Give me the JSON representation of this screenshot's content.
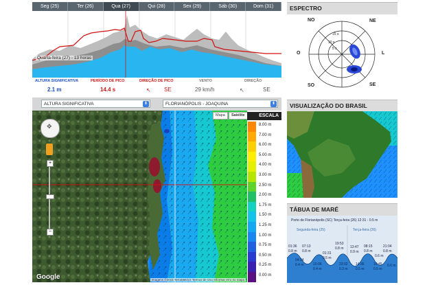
{
  "forecast": {
    "days": [
      "Seg (25)",
      "Ter (26)",
      "Qua (27)",
      "Qui (28)",
      "Sex (29)",
      "Sáb (30)",
      "Dom (31)"
    ],
    "tooltip": "Quarta-feira (27) - 13 horas",
    "metrics": [
      {
        "label": "ALTURA SIGNIFICATIVA",
        "value": "2.1 m",
        "color": "#1a50c8"
      },
      {
        "label": "PERÍODO DE PICO",
        "value": "14.4 s",
        "color": "#c81818"
      },
      {
        "label": "DIREÇÃO DE PICO",
        "value": "SE",
        "color": "#c81818"
      },
      {
        "label": "VENTO",
        "value": "29 km/h",
        "color": "#777777"
      },
      {
        "label": "DIREÇÃO",
        "value": "SE",
        "color": "#777777"
      }
    ]
  },
  "map_controls": {
    "variable": "ALTURA SIGNIFICATIVA",
    "location": "FLORIANÓPOLIS - JOAQUINA",
    "map_button": "Mapa",
    "satellite_button": "Satélite"
  },
  "scale": {
    "title": "ESCALA",
    "items": [
      {
        "label": "8.00 m",
        "color": "#ff8800"
      },
      {
        "label": "7.00 m",
        "color": "#ffaa00"
      },
      {
        "label": "6.00 m",
        "color": "#ffd000"
      },
      {
        "label": "5.00 m",
        "color": "#ffee00"
      },
      {
        "label": "4.00 m",
        "color": "#e4f000"
      },
      {
        "label": "3.00 m",
        "color": "#b6e600"
      },
      {
        "label": "2.50 m",
        "color": "#5ed42a"
      },
      {
        "label": "2.00 m",
        "color": "#22c066"
      },
      {
        "label": "1.75 m",
        "color": "#14d2c0"
      },
      {
        "label": "1.50 m",
        "color": "#14c4e8"
      },
      {
        "label": "1.25 m",
        "color": "#14a8f0"
      },
      {
        "label": "1.00 m",
        "color": "#1a86f0"
      },
      {
        "label": "0.75 m",
        "color": "#2060e0"
      },
      {
        "label": "0.50 m",
        "color": "#2a3ad0"
      },
      {
        "label": "0.25 m",
        "color": "#3a20b0"
      },
      {
        "label": "0.00 m",
        "color": "#5a1080"
      }
    ]
  },
  "map": {
    "google": "Google",
    "attribution": "Imagens ©2015 TerraMetrics   Termos de Uso   Informar erro no mapa"
  },
  "spectro": {
    "title": "ESPECTRO",
    "directions": [
      "NO",
      "NE",
      "O",
      "L",
      "SO",
      "SE"
    ],
    "rings": [
      "15 s",
      "10 s",
      "5 s"
    ]
  },
  "brasil": {
    "title": "VISUALIZAÇÃO DO BRASIL"
  },
  "mare": {
    "title": "TÁBUA DE MARÉ",
    "header": "Porto de Florianópolis (SC)   Terça-feira (26)  12:31 - 0.5 m",
    "days": [
      "Segunda-feira (25)",
      "Terça-feira (26)"
    ],
    "times_top": [
      "01:36",
      "07:13",
      "19:53",
      "08:15",
      "21:04"
    ],
    "heights_top": [
      "0.8 m",
      "0.8 m",
      "0.8 m",
      "0.8 m",
      "0.8 m"
    ],
    "times_mid": [
      "04:24",
      "10:06",
      "23:02",
      "14:36",
      "10:45"
    ],
    "heights_mid": [
      "0.4 m",
      "0.4 m",
      "0.3 m",
      "0.5 m",
      "0.5 m"
    ],
    "extra": [
      "13:47",
      "0.9 m",
      "01:31",
      "0.5 m",
      "0.6 m",
      "0.6 m"
    ]
  },
  "colors": {
    "wave_fill": "#29b6f0",
    "period_line": "#d01010",
    "header_gray": "#dcdcdc"
  }
}
